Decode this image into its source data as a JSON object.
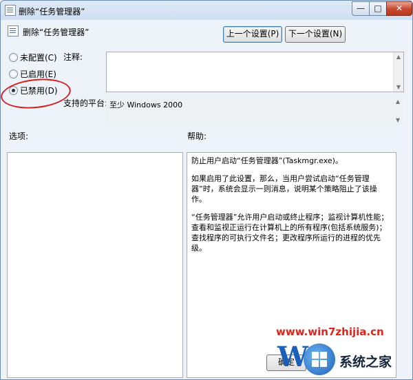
{
  "window": {
    "title": "删除“任务管理器”",
    "min_label": "—",
    "max_label": "□",
    "close_label": "✕"
  },
  "header": {
    "policy_name": "删除“任务管理器”",
    "prev_button": "上一个设置(P)",
    "next_button": "下一个设置(N)"
  },
  "state": {
    "options": [
      {
        "label": "未配置(C)",
        "selected": false
      },
      {
        "label": "已启用(E)",
        "selected": false
      },
      {
        "label": "已禁用(D)",
        "selected": true
      }
    ]
  },
  "comment": {
    "label": "注释:",
    "value": ""
  },
  "platform": {
    "label": "支持的平台:",
    "value": "至少 Windows 2000"
  },
  "options_panel": {
    "label": "选项:"
  },
  "help_panel": {
    "label": "帮助:",
    "paragraphs": [
      "防止用户启动“任务管理器”(Taskmgr.exe)。",
      "如果启用了此设置，那么，当用户尝试启动“任务管理器”时，系统会显示一则消息，说明某个策略阻止了该操作。",
      "“任务管理器”允许用户启动或终止程序；监视计算机性能；查看和监视正运行在计算机上的所有程序(包括系统服务)；查找程序的可执行文件名；更改程序所运行的进程的优先级。"
    ]
  },
  "footer": {
    "ok_button": "确定"
  },
  "watermark": {
    "url": "www.win7zhijia.cn",
    "brand_letter": "W",
    "name": "系统之家"
  }
}
